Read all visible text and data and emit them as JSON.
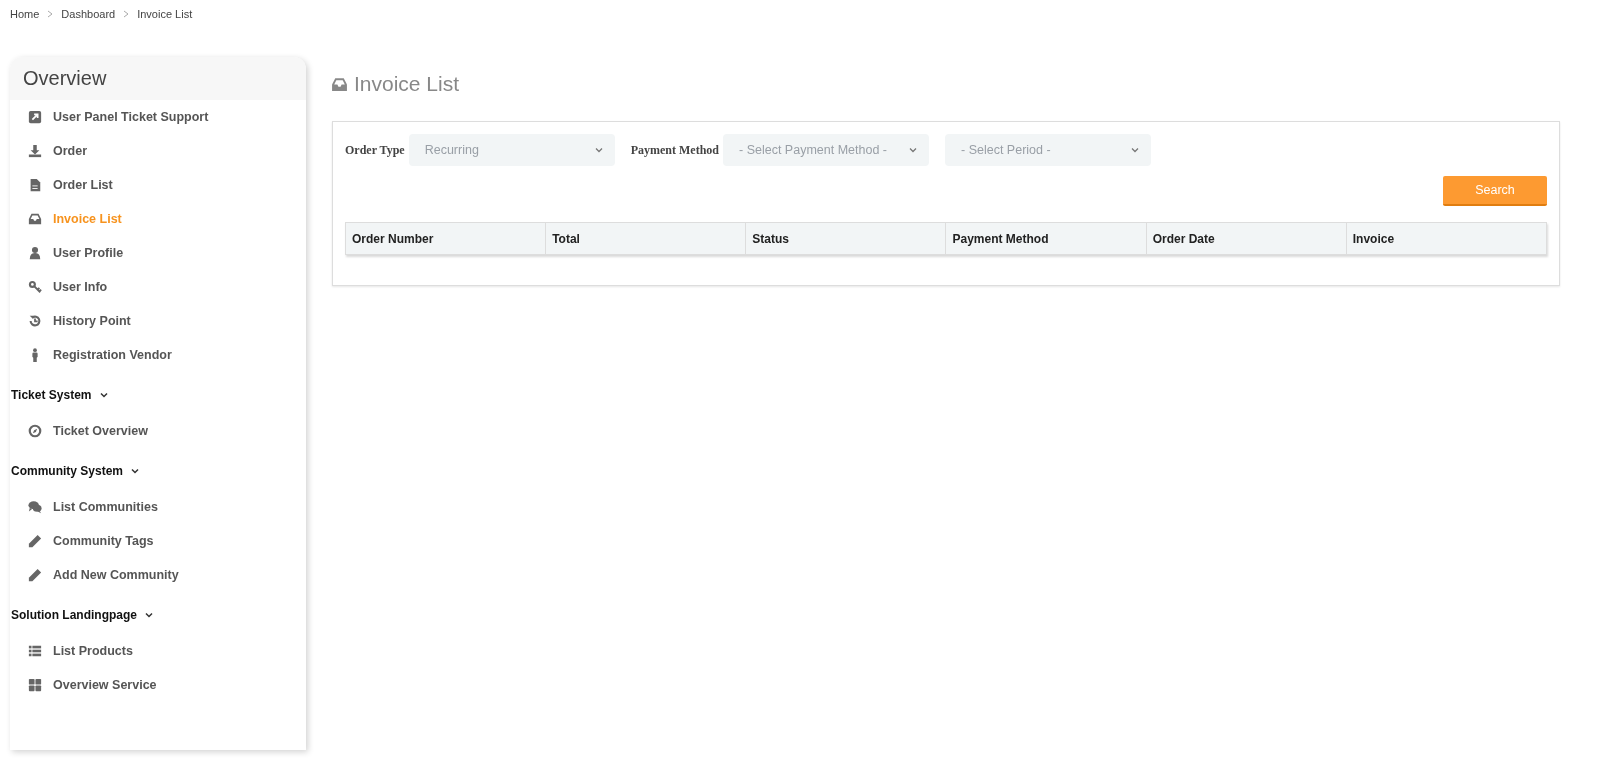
{
  "breadcrumb": [
    "Home",
    "Dashboard",
    "Invoice List"
  ],
  "sidebar": {
    "title": "Overview",
    "items": [
      {
        "label": "User Panel Ticket Support",
        "selected": false
      },
      {
        "label": "Order",
        "selected": false
      },
      {
        "label": "Order List",
        "selected": false
      },
      {
        "label": "Invoice List",
        "selected": true
      },
      {
        "label": "User Profile",
        "selected": false
      },
      {
        "label": "User Info",
        "selected": false
      },
      {
        "label": "History Point",
        "selected": false
      },
      {
        "label": "Registration Vendor",
        "selected": false
      }
    ],
    "groups": [
      {
        "title": "Ticket System",
        "expanded": true,
        "items": [
          {
            "label": "Ticket Overview",
            "selected": false
          }
        ]
      },
      {
        "title": "Community System",
        "expanded": true,
        "items": [
          {
            "label": "List Communities",
            "selected": false
          },
          {
            "label": "Community Tags",
            "selected": false
          },
          {
            "label": "Add New Community",
            "selected": false
          }
        ]
      },
      {
        "title": "Solution Landingpage",
        "expanded": true,
        "items": [
          {
            "label": "List Products",
            "selected": false
          },
          {
            "label": "Overview Service",
            "selected": false
          }
        ]
      }
    ]
  },
  "page_title": "Invoice List",
  "filters": [
    {
      "label": "Order Type",
      "value": "Recurring"
    },
    {
      "label": "Payment Method",
      "placeholder": "- Select Payment Method -"
    },
    {
      "placeholder": "- Select Period -"
    }
  ],
  "search_button": "Search",
  "table": {
    "columns": [
      "Order Number",
      "Total",
      "Status",
      "Payment Method",
      "Order Date",
      "Invoice"
    ]
  }
}
